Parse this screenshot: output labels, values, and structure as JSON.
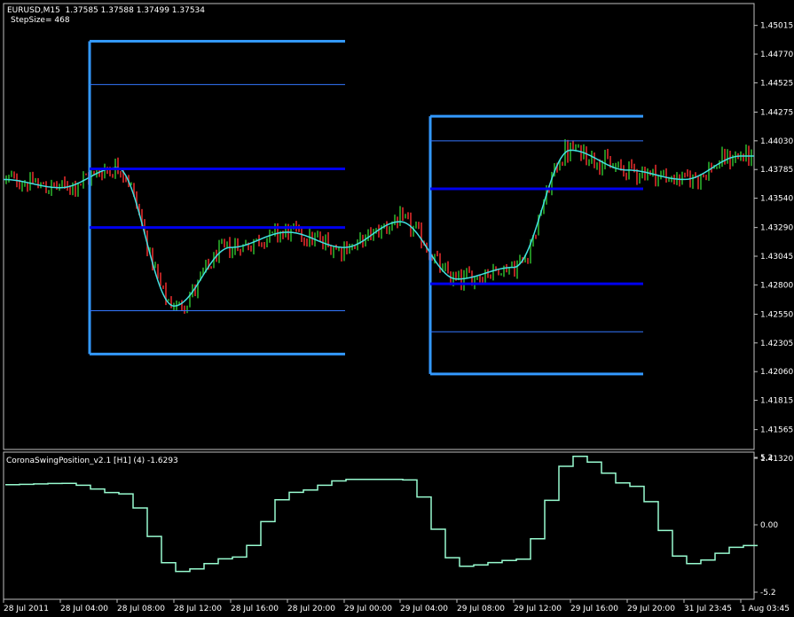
{
  "main": {
    "header_line1": "EURUSD,M15  1.37585 1.37588 1.37499 1.37534",
    "header_line2": "StepSize= 468",
    "price_ticks": [
      "1.45015",
      "1.44770",
      "1.44525",
      "1.44275",
      "1.44030",
      "1.43785",
      "1.43540",
      "1.43290",
      "1.43045",
      "1.42800",
      "1.42550",
      "1.42305",
      "1.42060",
      "1.41815",
      "1.41565",
      "1.41320"
    ]
  },
  "indicator": {
    "title": "CoronaSwingPosition_v2.1 [H1] (4) -1.6293",
    "ticks": [
      "5.2",
      "0.00",
      "-5.2"
    ]
  },
  "time_axis": [
    "28 Jul 2011",
    "28 Jul 04:00",
    "28 Jul 08:00",
    "28 Jul 12:00",
    "28 Jul 16:00",
    "28 Jul 20:00",
    "29 Jul 00:00",
    "29 Jul 04:00",
    "29 Jul 08:00",
    "29 Jul 12:00",
    "29 Jul 16:00",
    "29 Jul 20:00",
    "31 Jul 23:45",
    "1 Aug 03:45"
  ],
  "colors": {
    "background": "#000000",
    "bull_bar": "#228b22",
    "bear_bar": "#b22222",
    "smooth_line": "#40e0e0",
    "box_frame": "#3399ff",
    "thick_level": "#0000ee",
    "thin_level": "#3377ff",
    "indicator_line": "#98fbd0",
    "grid_border": "#c0c0c0",
    "text": "#ffffff"
  },
  "chart_data": {
    "type": "line",
    "main_smooth": {
      "x": [
        "28 Jul 2011",
        "28 Jul 04:00",
        "28 Jul 08:00",
        "28 Jul 12:00",
        "28 Jul 16:00",
        "28 Jul 20:00",
        "29 Jul 00:00",
        "29 Jul 04:00",
        "29 Jul 08:00",
        "29 Jul 12:00",
        "29 Jul 16:00",
        "29 Jul 20:00",
        "31 Jul 23:45",
        "1 Aug 03:45"
      ],
      "y": [
        1.437,
        1.4363,
        1.438,
        1.4262,
        1.4312,
        1.4325,
        1.4312,
        1.4334,
        1.4285,
        1.4295,
        1.4395,
        1.4378,
        1.437,
        1.439
      ]
    },
    "swing_boxes": [
      {
        "top": 1.4488,
        "levels": [
          1.4451,
          1.4379,
          1.4329,
          1.4258
        ],
        "bottom": 1.4221
      },
      {
        "top": 1.4424,
        "levels": [
          1.4403,
          1.4362,
          1.4281,
          1.424
        ],
        "bottom": 1.4204
      }
    ],
    "indicator_series": {
      "name": "CoronaSwingPosition_v2.1",
      "x": [
        "28 Jul 2011",
        "28 Jul 04:00",
        "28 Jul 08:00",
        "28 Jul 12:00",
        "28 Jul 16:00",
        "28 Jul 20:00",
        "29 Jul 00:00",
        "29 Jul 04:00",
        "29 Jul 08:00",
        "29 Jul 12:00",
        "29 Jul 16:00",
        "29 Jul 20:00",
        "31 Jul 23:45",
        "1 Aug 03:45"
      ],
      "y": [
        3.1,
        3.2,
        2.4,
        -3.6,
        -2.5,
        2.5,
        3.5,
        3.5,
        -3.2,
        -2.7,
        5.3,
        3.0,
        -3.0,
        -1.6
      ]
    },
    "ylim_main": [
      1.4132,
      1.4502
    ],
    "ylim_indicator": [
      -5.2,
      5.2
    ]
  }
}
